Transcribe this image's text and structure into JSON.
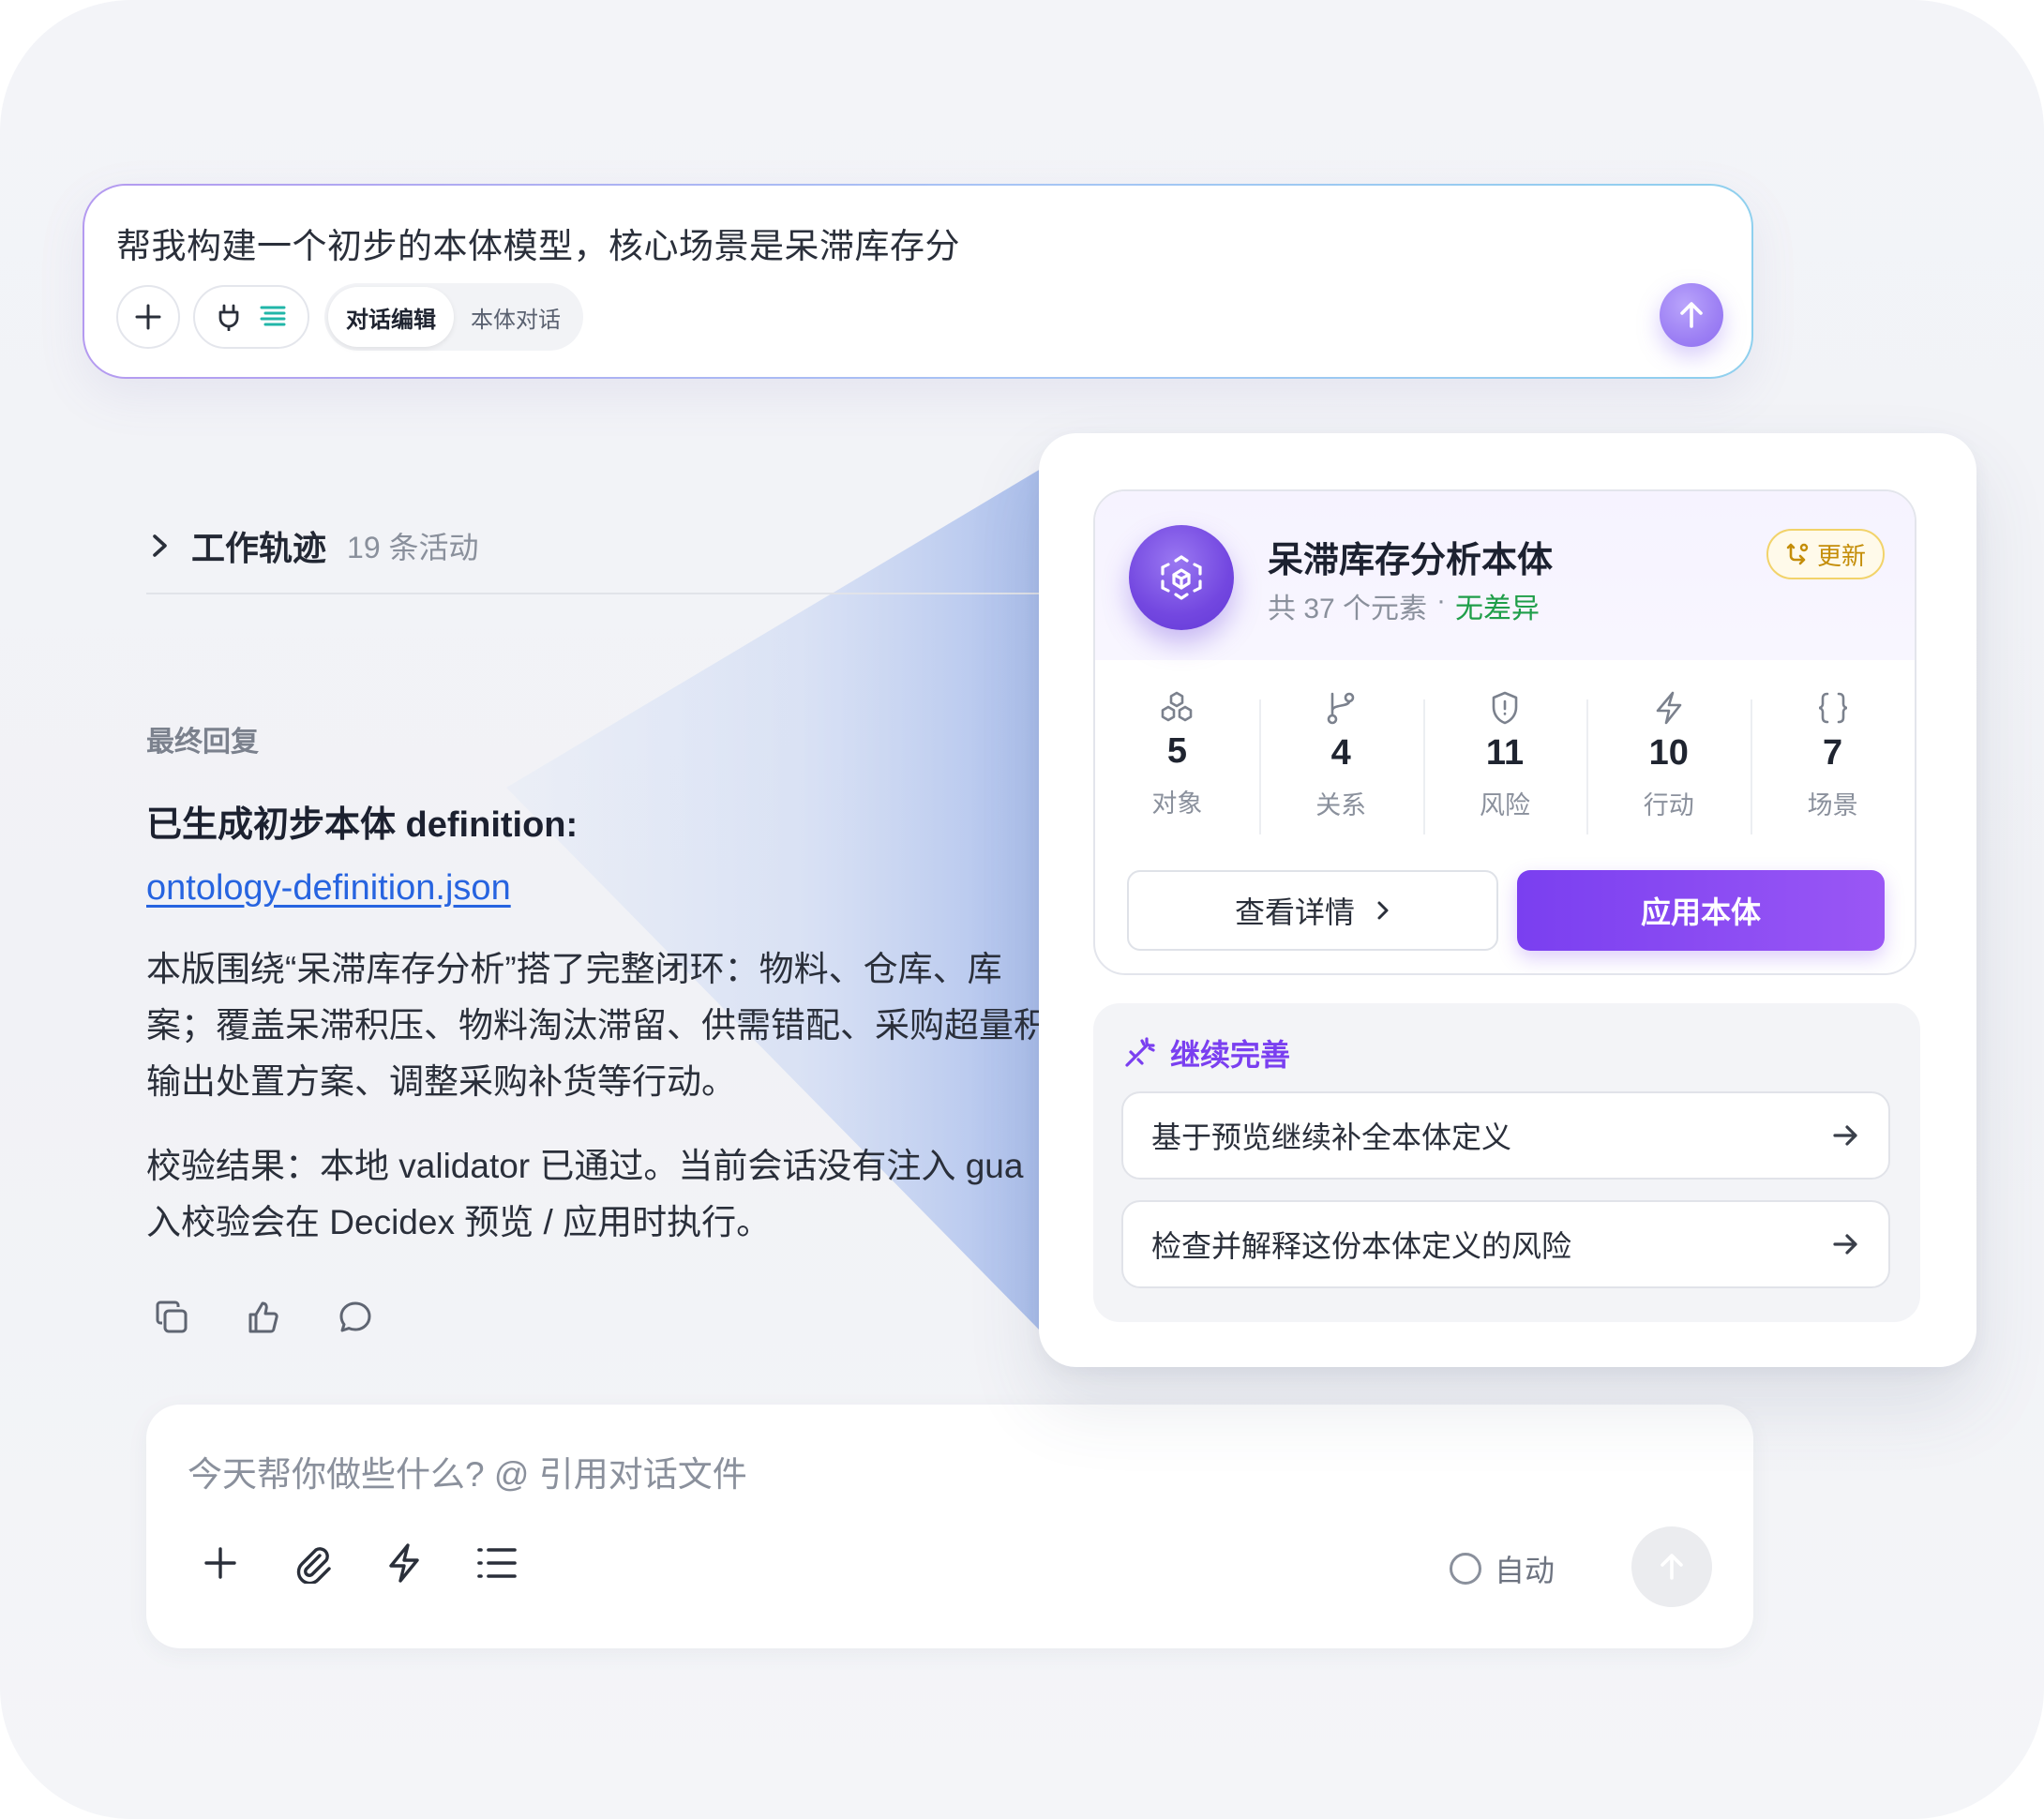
{
  "prompt": {
    "text": "帮我构建一个初步的本体模型，核心场景是呆滞库存分",
    "modes": [
      "对话编辑",
      "本体对话"
    ],
    "active_mode": "对话编辑"
  },
  "trace": {
    "title": "工作轨迹",
    "count": "19 条活动"
  },
  "reply": {
    "label": "最终回复",
    "heading": "已生成初步本体 definition:",
    "file_link": "ontology-definition.json",
    "para1_line1": "本版围绕“呆滞库存分析”搭了完整闭环：物料、仓库、库",
    "para1_line2": "案；覆盖呆滞积压、物料淘汰滞留、供需错配、采购超量积",
    "para1_line3": "输出处置方案、调整采购补货等行动。",
    "para2_line1": "校验结果：本地 validator 已通过。当前会话没有注入 gua",
    "para2_line2": "入校验会在 Decidex 预览 / 应用时执行。"
  },
  "composer": {
    "placeholder": "今天帮你做些什么? @ 引用对话文件",
    "auto_label": "自动"
  },
  "ontology_card": {
    "name": "呆滞库存分析本体",
    "element_count": "共 37 个元素",
    "separator": "·",
    "status": "无差异",
    "update_badge": "更新",
    "stats": [
      {
        "icon": "objects-icon",
        "value": "5",
        "label": "对象"
      },
      {
        "icon": "relations-icon",
        "value": "4",
        "label": "关系"
      },
      {
        "icon": "risk-shield-icon",
        "value": "11",
        "label": "风险"
      },
      {
        "icon": "lightning-icon",
        "value": "10",
        "label": "行动"
      },
      {
        "icon": "braces-icon",
        "value": "7",
        "label": "场景"
      }
    ],
    "detail_button": "查看详情",
    "apply_button": "应用本体"
  },
  "continue": {
    "title": "继续完善",
    "suggestions": [
      "基于预览继续补全本体定义",
      "检查并解释这份本体定义的风险"
    ]
  },
  "colors": {
    "accent_purple": "#7a3ff0",
    "link_blue": "#2764e0",
    "status_green": "#1f9e49",
    "badge_amber": "#c48d08"
  }
}
